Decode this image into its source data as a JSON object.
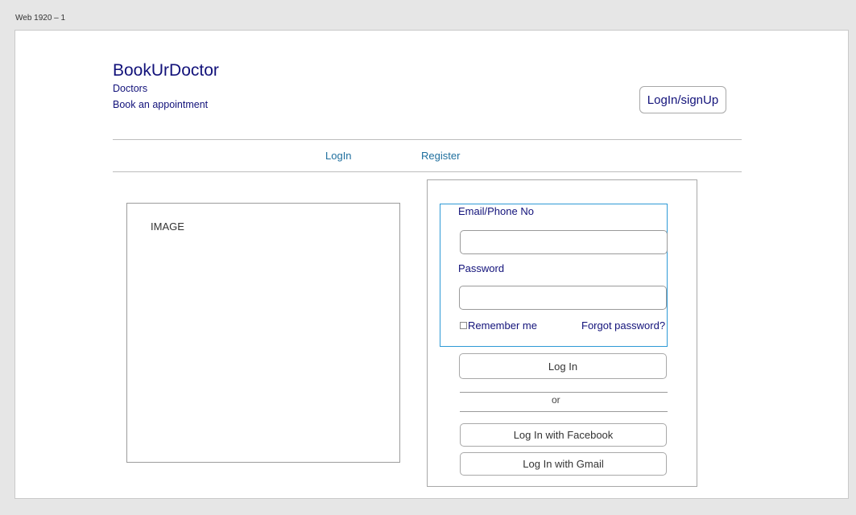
{
  "artboard": {
    "label": "Web 1920 – 1"
  },
  "header": {
    "brand": "BookUrDoctor",
    "nav": [
      "Doctors",
      "Book an appointment"
    ],
    "login_signup": "LogIn/signUp"
  },
  "tabs": [
    "LogIn",
    "Register"
  ],
  "image_placeholder": "IMAGE",
  "form": {
    "email_label": "Email/Phone No",
    "email_value": "",
    "password_label": "Password",
    "password_value": "",
    "remember_label": "Remember me",
    "forgot_label": "Forgot password?",
    "login_button": "Log In",
    "or_text": "or",
    "facebook_button": "Log In with Facebook",
    "gmail_button": "Log In with Gmail"
  },
  "colors": {
    "brand": "#12127a",
    "tab": "#1f6f9e",
    "selection": "#2e9ad6"
  }
}
